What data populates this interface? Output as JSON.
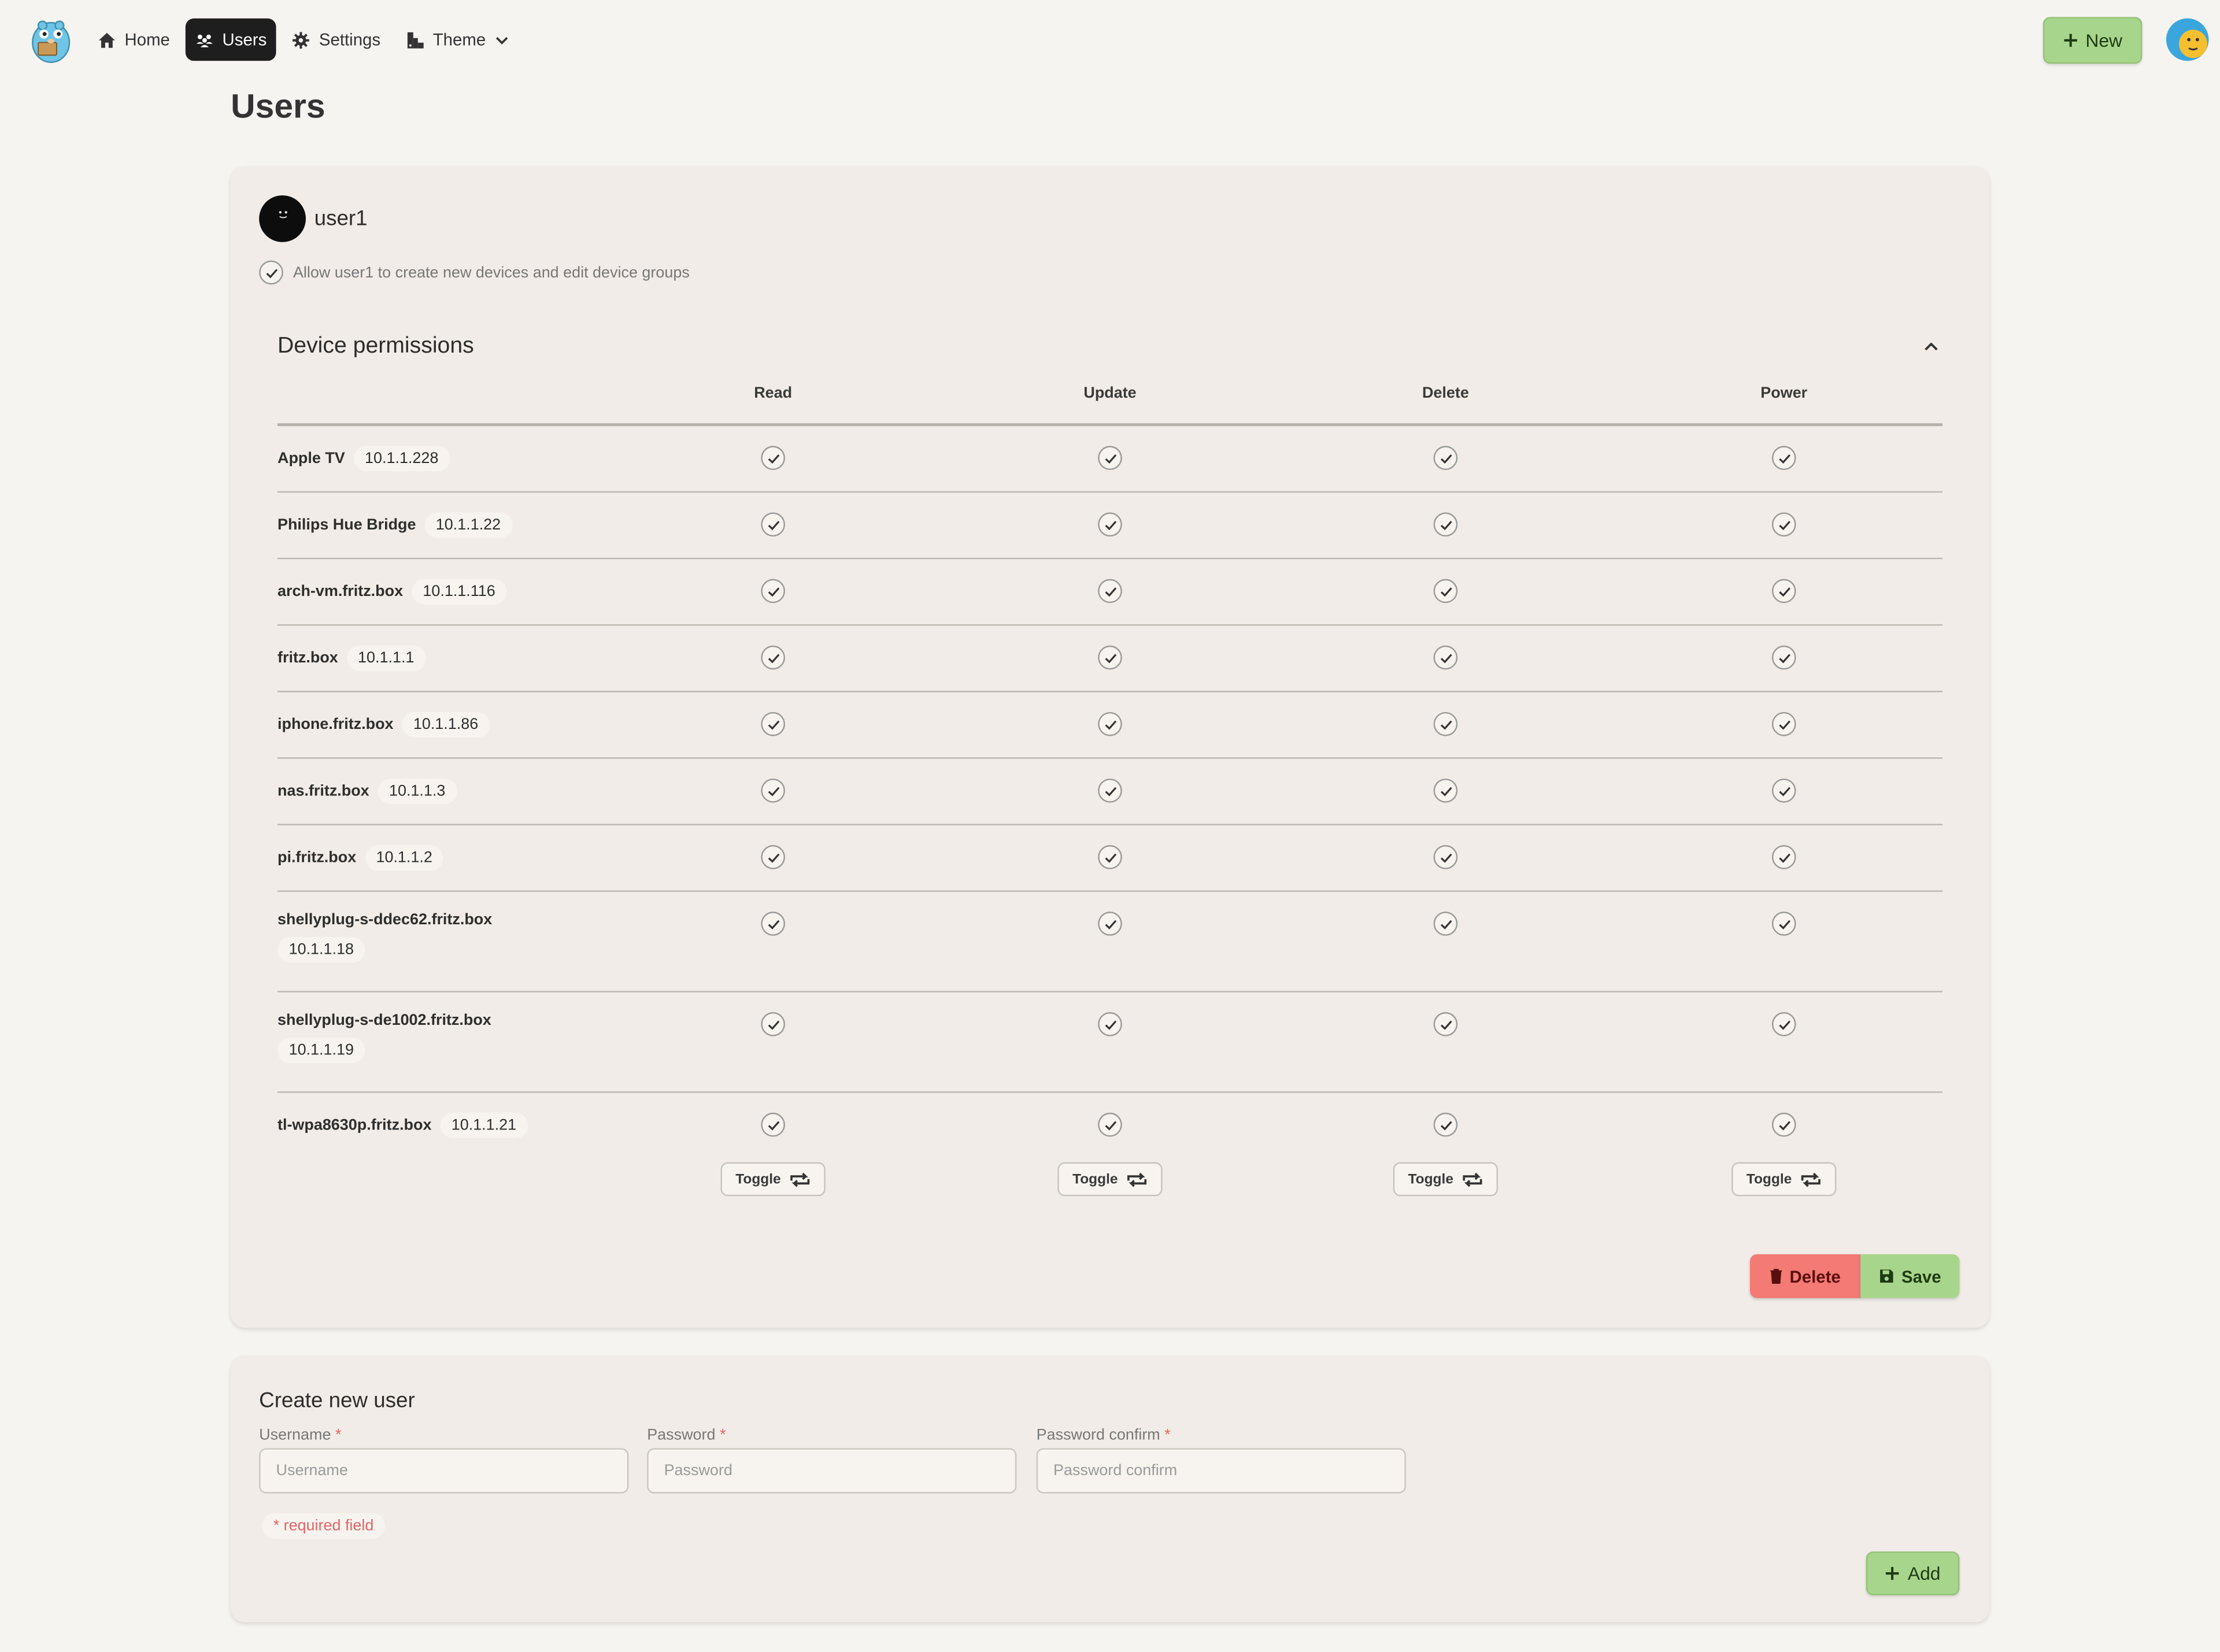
{
  "nav": {
    "items": [
      {
        "label": "Home",
        "icon": "home-icon",
        "active": false
      },
      {
        "label": "Users",
        "icon": "users-icon",
        "active": true
      },
      {
        "label": "Settings",
        "icon": "gear-icon",
        "active": false
      },
      {
        "label": "Theme",
        "icon": "theme-icon",
        "active": false
      }
    ],
    "new_label": "New"
  },
  "page": {
    "title": "Users"
  },
  "user": {
    "name": "user1",
    "allow_label": "Allow user1 to create new devices and edit device groups",
    "allow_checked": true
  },
  "permissions": {
    "title": "Device permissions",
    "columns": [
      "Read",
      "Update",
      "Delete",
      "Power"
    ],
    "devices": [
      {
        "name": "Apple TV",
        "ip": "10.1.1.228"
      },
      {
        "name": "Philips Hue Bridge",
        "ip": "10.1.1.22"
      },
      {
        "name": "arch-vm.fritz.box",
        "ip": "10.1.1.116"
      },
      {
        "name": "fritz.box",
        "ip": "10.1.1.1"
      },
      {
        "name": "iphone.fritz.box",
        "ip": "10.1.1.86"
      },
      {
        "name": "nas.fritz.box",
        "ip": "10.1.1.3"
      },
      {
        "name": "pi.fritz.box",
        "ip": "10.1.1.2"
      },
      {
        "name": "shellyplug-s-ddec62.fritz.box",
        "ip": "10.1.1.18"
      },
      {
        "name": "shellyplug-s-de1002.fritz.box",
        "ip": "10.1.1.19"
      },
      {
        "name": "tl-wpa8630p.fritz.box",
        "ip": "10.1.1.21"
      }
    ],
    "all_checked": true,
    "toggle_label": "Toggle",
    "delete_label": "Delete",
    "save_label": "Save"
  },
  "create": {
    "title": "Create new user",
    "username_label": "Username",
    "username_placeholder": "Username",
    "password_label": "Password",
    "password_placeholder": "Password",
    "confirm_label": "Password confirm",
    "confirm_placeholder": "Password confirm",
    "required_marker": "*",
    "required_note": "* required field",
    "add_label": "Add"
  },
  "colors": {
    "accent_green": "#a8d58c",
    "danger_red": "#f37a75",
    "nav_active": "#1e1e1e",
    "card_bg": "#f1ece7"
  }
}
